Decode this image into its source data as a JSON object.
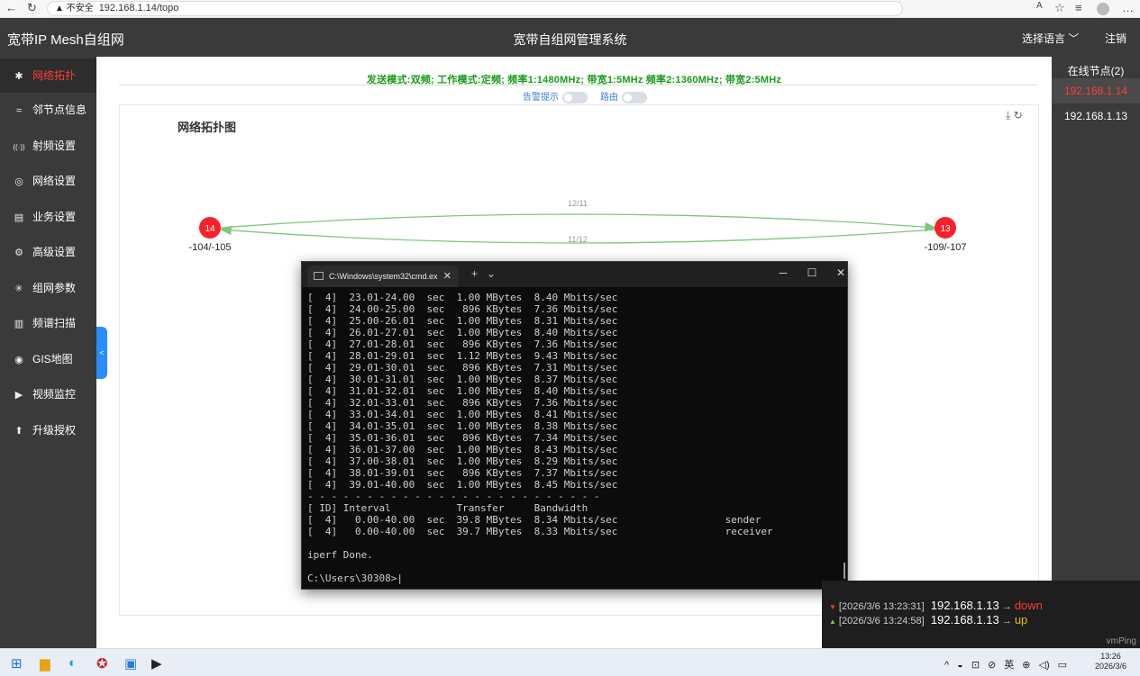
{
  "browser": {
    "url": "192.168.1.14/topo",
    "security_label": "▲ 不安全"
  },
  "header": {
    "brand": "宽带IP Mesh自组网",
    "title": "宽带自组网管理系统",
    "language": "选择语言",
    "logout": "注销"
  },
  "sidebar": {
    "items": [
      {
        "label": "网络拓扑",
        "icon": "network-topology-icon",
        "glyph": "✱",
        "active": true
      },
      {
        "label": "邻节点信息",
        "icon": "neighbor-icon",
        "glyph": "≈"
      },
      {
        "label": "射频设置",
        "icon": "radio-icon",
        "glyph": "((·))"
      },
      {
        "label": "网络设置",
        "icon": "globe-icon",
        "glyph": "◎"
      },
      {
        "label": "业务设置",
        "icon": "service-icon",
        "glyph": "▤"
      },
      {
        "label": "高级设置",
        "icon": "gear-icon",
        "glyph": "⚙"
      },
      {
        "label": "组网参数",
        "icon": "mesh-params-icon",
        "glyph": "✳"
      },
      {
        "label": "频谱扫描",
        "icon": "spectrum-icon",
        "glyph": "▥"
      },
      {
        "label": "GIS地图",
        "icon": "map-pin-icon",
        "glyph": "◉"
      },
      {
        "label": "视频监控",
        "icon": "camera-icon",
        "glyph": "▶"
      },
      {
        "label": "升级授权",
        "icon": "upgrade-icon",
        "glyph": "⬆"
      }
    ]
  },
  "status": {
    "text": "发送模式:双频;  工作模式:定频;  频率1:1480MHz;  带宽1:5MHz   频率2:1360MHz;  带宽2:5MHz",
    "alarm_label": "告警提示",
    "route_label": "路由"
  },
  "topology": {
    "title": "网络拓扑图",
    "node_left": {
      "id": "14",
      "signal": "-104/-105"
    },
    "node_right": {
      "id": "13",
      "signal": "-109/-107"
    },
    "link_top_label": "12/11",
    "link_bottom_label": "11/12",
    "node_color": "#f5222d",
    "link_color": "#7cc77c"
  },
  "online": {
    "header": "在线节点(2)",
    "nodes": [
      "192.168.1.14",
      "192.168.1.13"
    ]
  },
  "cmd": {
    "tab_title": "C:\\Windows\\system32\\cmd.ex",
    "lines": [
      "[  4]  23.01-24.00  sec  1.00 MBytes  8.40 Mbits/sec",
      "[  4]  24.00-25.00  sec   896 KBytes  7.36 Mbits/sec",
      "[  4]  25.00-26.01  sec  1.00 MBytes  8.31 Mbits/sec",
      "[  4]  26.01-27.01  sec  1.00 MBytes  8.40 Mbits/sec",
      "[  4]  27.01-28.01  sec   896 KBytes  7.36 Mbits/sec",
      "[  4]  28.01-29.01  sec  1.12 MBytes  9.43 Mbits/sec",
      "[  4]  29.01-30.01  sec   896 KBytes  7.31 Mbits/sec",
      "[  4]  30.01-31.01  sec  1.00 MBytes  8.37 Mbits/sec",
      "[  4]  31.01-32.01  sec  1.00 MBytes  8.40 Mbits/sec",
      "[  4]  32.01-33.01  sec   896 KBytes  7.36 Mbits/sec",
      "[  4]  33.01-34.01  sec  1.00 MBytes  8.41 Mbits/sec",
      "[  4]  34.01-35.01  sec  1.00 MBytes  8.38 Mbits/sec",
      "[  4]  35.01-36.01  sec   896 KBytes  7.34 Mbits/sec",
      "[  4]  36.01-37.00  sec  1.00 MBytes  8.43 Mbits/sec",
      "[  4]  37.00-38.01  sec  1.00 MBytes  8.29 Mbits/sec",
      "[  4]  38.01-39.01  sec   896 KBytes  7.37 Mbits/sec",
      "[  4]  39.01-40.00  sec  1.00 MBytes  8.45 Mbits/sec",
      "- - - - - - - - - - - - - - - - - - - - - - - - -",
      "[ ID] Interval           Transfer     Bandwidth",
      "[  4]   0.00-40.00  sec  39.8 MBytes  8.34 Mbits/sec                  sender",
      "[  4]   0.00-40.00  sec  39.7 MBytes  8.33 Mbits/sec                  receiver",
      "",
      "iperf Done.",
      "",
      "C:\\Users\\30308>"
    ]
  },
  "notifications": {
    "items": [
      {
        "time": "[2026/3/6 13:23:31]",
        "ip": "192.168.1.13",
        "arrow": "→",
        "state": "down"
      },
      {
        "time": "[2026/3/6 13:24:58]",
        "ip": "192.168.1.13",
        "arrow": "→",
        "state": "up"
      }
    ],
    "app_name": "vmPing"
  },
  "taskbar": {
    "ime": "英",
    "time": "13:26",
    "date": "2026/3/6"
  }
}
